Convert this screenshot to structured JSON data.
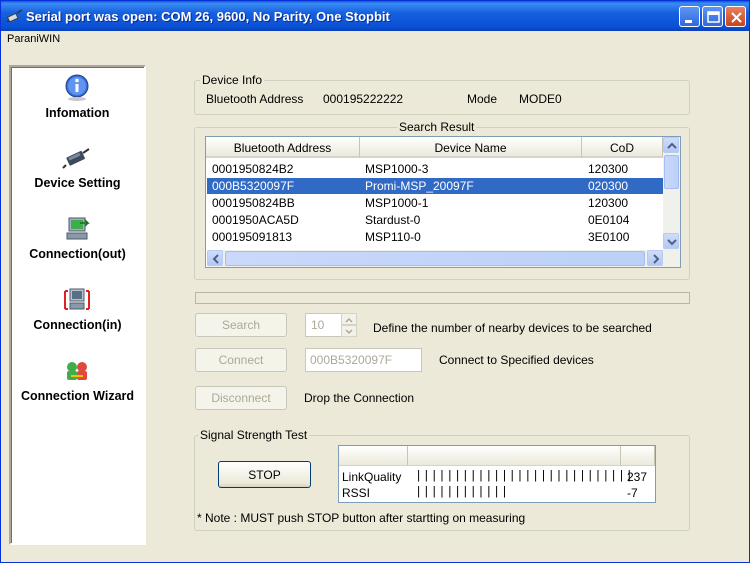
{
  "window": {
    "title": "Serial port was open: COM 26, 9600, No Parity, One Stopbit",
    "menu": "ParaniWIN"
  },
  "sidebar": {
    "items": [
      {
        "label": "Infomation",
        "icon": "info-icon"
      },
      {
        "label": "Device Setting",
        "icon": "serial-device-icon"
      },
      {
        "label": "Connection(out)",
        "icon": "connection-out-icon"
      },
      {
        "label": "Connection(in)",
        "icon": "connection-in-icon"
      },
      {
        "label": "Connection Wizard",
        "icon": "wizard-icon"
      }
    ]
  },
  "device_info": {
    "legend": "Device Info",
    "address_label": "Bluetooth Address",
    "address_value": "000195222222",
    "mode_label": "Mode",
    "mode_value": "MODE0"
  },
  "search_result": {
    "legend": "Search Result",
    "columns": [
      "Bluetooth Address",
      "Device Name",
      "CoD"
    ],
    "rows": [
      {
        "address": "0001950824B2",
        "name": "MSP1000-3",
        "cod": "120300",
        "selected": false
      },
      {
        "address": "000B5320097F",
        "name": "Promi-MSP_20097F",
        "cod": "020300",
        "selected": true
      },
      {
        "address": "0001950824BB",
        "name": "MSP1000-1",
        "cod": "120300",
        "selected": false
      },
      {
        "address": "0001950ACA5D",
        "name": "Stardust-0",
        "cod": "0E0104",
        "selected": false
      },
      {
        "address": "000195091813",
        "name": "MSP110-0",
        "cod": "3E0100",
        "selected": false
      }
    ]
  },
  "controls": {
    "search_button": "Search",
    "search_count": "10",
    "search_desc": "Define the number of nearby devices to be searched",
    "connect_button": "Connect",
    "connect_address": "000B5320097F",
    "connect_desc": "Connect to Specified devices",
    "disconnect_button": "Disconnect",
    "disconnect_desc": "Drop the Connection"
  },
  "signal": {
    "legend": "Signal Strength Test",
    "stop_button": "STOP",
    "rows": [
      {
        "label": "LinkQuality",
        "bar": "||||||||||||||||||||||||||||",
        "value": "237"
      },
      {
        "label": "RSSI",
        "bar": "||||||||||||",
        "value": "-7"
      }
    ],
    "note": "* Note : MUST push STOP button after startting on measuring"
  },
  "colors": {
    "title_bar": "#0a4fd3",
    "selection": "#316ac5",
    "window_bg": "#ece9d8"
  }
}
